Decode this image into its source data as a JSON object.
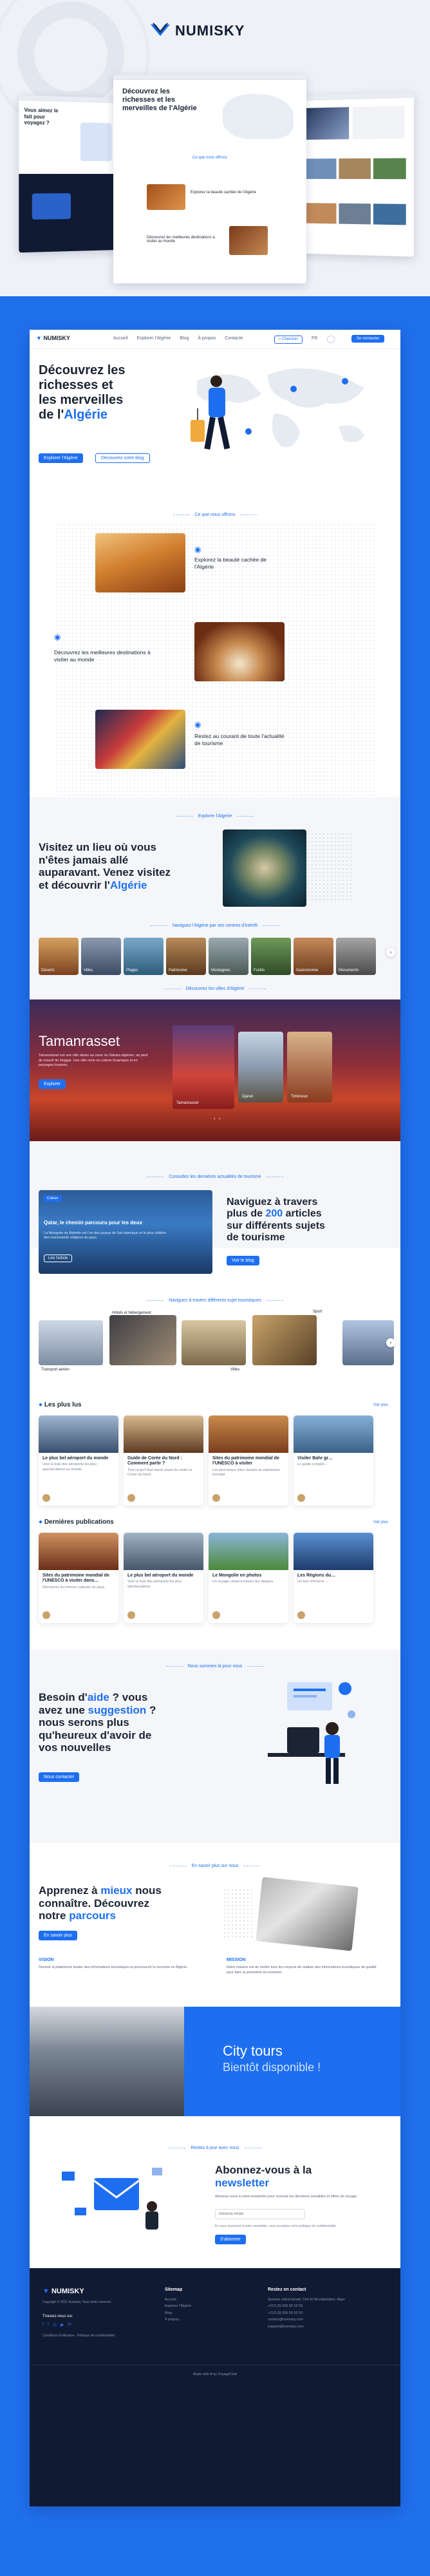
{
  "brand": {
    "name": "NUMISKY",
    "accent": "#1e6ff0",
    "dark": "#111a33"
  },
  "showcase": {
    "left_mock_title": "Vous aimez le fait pour voyagez ?",
    "center_mock_title": "Découvrez les richesses et les merveilles de l'Algérie",
    "center_caption_1": "Explorez la beauté cachée de l'Algérie",
    "center_caption_2": "Découvrez les meilleures destinations à visiter au monde",
    "center_section": "Ce que nous offrons"
  },
  "nav": {
    "logo": "NUMISKY",
    "links": [
      "Accueil",
      "Explorer l'Algérie",
      "Blog",
      "À propos",
      "Contacte"
    ],
    "search_label": "Chercher",
    "lang_label": "FR",
    "cta_label": "Se connecter"
  },
  "hero": {
    "title_1": "Découvrez les",
    "title_2": "richesses et",
    "title_3": "les merveilles",
    "title_4": "de l'",
    "title_accent": "Algérie",
    "btn_primary": "Explorer l'Algérie",
    "btn_secondary": "Découvrez notre blog"
  },
  "offer": {
    "section": "Ce que nous offrons",
    "item1": "Explorez la beauté cachée de l'Algérie",
    "item2": "Découvrez les meilleures destinations à visiter au monde",
    "item3": "Restez au courant de toute l'actualité de tourisme"
  },
  "explore": {
    "section": "Explorer l'Algérie",
    "title_1": "Visitez un lieu où vous",
    "title_2": "n'êtes jamais allé",
    "title_3": "auparavant. Venez visitez",
    "title_4": "et découvrir l'",
    "title_accent": "Algérie"
  },
  "centers": {
    "section": "Naviguez l'Algérie par ses centres d'intérêt",
    "items": [
      "Déserts",
      "Villes",
      "Plages",
      "Patrimoine",
      "Montagnes",
      "Forêts",
      "Gastronomie",
      "Monuments"
    ]
  },
  "cities": {
    "section": "Découvrez les villes d'Algérie",
    "city": "Tamanrasset",
    "desc": "Tamanrasset est une ville située au cœur du Sahara algérien, au pied du massif du Hoggar. Une ville riche en culture touarègue et en paysages lunaires.",
    "btn": "Explorer",
    "mini_labels": [
      "Tamanrasset",
      "Djanet",
      "Timimoun"
    ]
  },
  "news": {
    "section": "Consultez les dernières actualités de tourisme",
    "card_tag": "Culture",
    "card_title": "Qatar, le chemin parcouru pour les deux",
    "card_desc": "La Mosquée de Babelle est l'un des joyaux de l'art islamique et le plus célèbre des monuments religieux du pays.",
    "card_btn": "Lire l'article",
    "title_1": "Naviguez à travers",
    "title_2": "plus de ",
    "title_num": "200",
    "title_3": " articles",
    "title_4": "sur différents sujets",
    "title_5": "de tourisme",
    "btn": "Voir le blog"
  },
  "topics": {
    "section": "Naviguez à travers différents sujet touristiques",
    "items": [
      "Transport aérien",
      "Hôtels et hébergement",
      "Villes",
      "Sport"
    ]
  },
  "popular": {
    "title": "Les plus lus",
    "more": "Voir plus",
    "cards": [
      {
        "t": "Le plus bel aéroport du monde",
        "d": "Voici la liste des aéroports les plus spectaculaires au monde."
      },
      {
        "t": "Guide de Corée du Nord : Comment partir ?",
        "d": "Tout ce qu'il faut savoir avant de visiter la Corée du Nord."
      },
      {
        "t": "Sites du patrimoine mondial de l'UNESCO à visiter",
        "d": "Les plus beaux sites classés au patrimoine mondial."
      },
      {
        "t": "Visiter Bahr gr…",
        "d": "Le guide complet…"
      }
    ]
  },
  "latest": {
    "title": "Dernières publications",
    "more": "Voir plus",
    "cards": [
      {
        "t": "Sites du patrimoine mondial de l'UNESCO à visiter dans…",
        "d": "Découvrez les trésors culturels du pays."
      },
      {
        "t": "Le plus bel aéroport du monde",
        "d": "Voici la liste des aéroports les plus spectaculaires."
      },
      {
        "t": "Le Mongolie en photos",
        "d": "Un voyage visuel à travers les steppes."
      },
      {
        "t": "Les Régions du…",
        "d": "Un tour d'horizon…"
      }
    ]
  },
  "help": {
    "section": "Nous sommes là pour vous",
    "l1": "Besoin d'",
    "l1_accent": "aide",
    "l1_end": " ? vous",
    "l2": "avez une ",
    "l2_accent": "suggestion",
    "l2_end": " ?",
    "l3": "nous serons plus",
    "l4": "qu'heureux d'avoir de",
    "l5": "vos nouvelles",
    "btn": "Nous contacter"
  },
  "about": {
    "section": "En savoir plus sur nous",
    "l1": "Apprenez à ",
    "l1_accent": "mieux",
    "l1_end": " nous",
    "l2": "connaître. Découvrez",
    "l3": "notre ",
    "l3_accent": "parcours",
    "btn": "En savoir plus",
    "vision_title": "VISION",
    "vision_text": "Devenir la plateforme leader des informations touristiques et promouvoir le tourisme en Algérie.",
    "mission_title": "MISSION",
    "mission_text": "Notre mission est de mettre tous les moyens de réaliser des informations touristiques de qualité pour faire la promotion du tourisme."
  },
  "city_tours": {
    "title": "City tours",
    "subtitle": "Bientôt disponible !"
  },
  "newsletter": {
    "section": "Restez à jour avec nous",
    "title_1": "Abonnez-vous à la",
    "title_accent": "newsletter",
    "desc": "Abonnez-vous à notre newsletter pour recevoir les dernières actualités et offres de voyage.",
    "placeholder": "Adresse email",
    "consent": "En vous inscrivant à notre newsletter, vous acceptez notre politique de confidentialité.",
    "btn": "S'abonner"
  },
  "footer": {
    "logo": "NUMISKY",
    "tagline": "Copyright © 2021 Numisky. Tous droits réservés.",
    "social_title": "Trouvez-nous sur",
    "links": "Conditions d'utilisation · Politique de confidentialité",
    "sitemap_title": "Sitemap",
    "sitemap": [
      "Accueil",
      "Explorer l'Algérie",
      "Blog",
      "À propos"
    ],
    "contact_title": "Restez en contact",
    "contact": [
      "Quartier administratif, Cité El Moudjahidine, Alger",
      "+213 (0) 555 55 55 55",
      "+213 (0) 555 55 55 55",
      "contact@numisky.com",
      "support@numisky.com"
    ],
    "made": "Made with ♥ by VoyageClub"
  },
  "icons": [
    "search-icon",
    "location-pin-icon",
    "rss-icon",
    "arrow-right-icon",
    "arrow-left-icon",
    "star-icon",
    "facebook-icon",
    "twitter-icon",
    "instagram-icon",
    "youtube-icon",
    "mail-icon",
    "globe-icon"
  ]
}
